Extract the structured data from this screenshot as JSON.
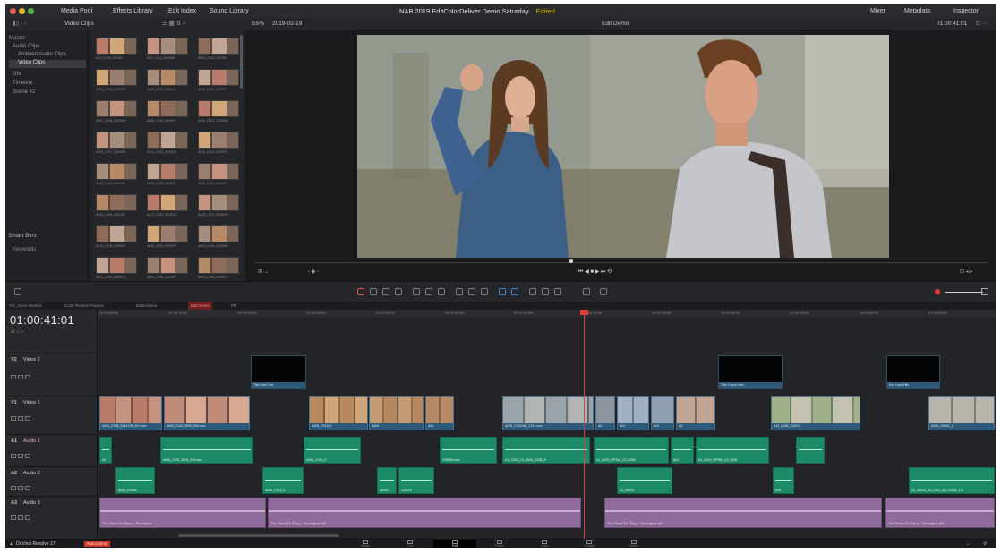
{
  "titlebar": {
    "tabs": [
      "Media Pool",
      "Effects Library",
      "Edit Index",
      "Sound Library"
    ],
    "title": "NAB 2019 EditColorDeliver Demo Saturday",
    "status": "Edited",
    "right_tabs": [
      "Mixer",
      "Metadata",
      "Inspector"
    ]
  },
  "toolbar2": {
    "bin": "Video Clips",
    "zoom": "55%",
    "timeline_name": "2019-02-19",
    "view": "Edit Demo",
    "source_tc": "01:00:41:01"
  },
  "bins": {
    "items": [
      "Master",
      "Audio Clips",
      "Ambient Audio Clips",
      "Video Clips",
      "Gfx",
      "Timeline",
      "Scene 42"
    ],
    "selected": "Video Clips",
    "smart_bins_label": "Smart Bins",
    "keywords_label": "Keywords"
  },
  "media_pool": {
    "clips": [
      "A01_C008_0519IR",
      "A02_C014_0520BB",
      "A003_C021_0520BC",
      "A004_C015_0519GR",
      "A005_C022_0521LK",
      "A006_C011_0520TT",
      "A007_C016_0519MR",
      "A008_C023_0519LP",
      "A009_C012_0520WA",
      "A010_C017_0521BM",
      "A011_C024_0519QN",
      "A012_C013_0520FD",
      "A013_C018_0521XR",
      "A014_C025_0519LK",
      "A015_C019_0520YT",
      "A016_C026_0521ZE",
      "A017_C020_0519CD",
      "A018_C027_0520HV",
      "A019_C028_0520KK",
      "A020_C029_0521RP",
      "A021_C030_0519MN",
      "A022_C031_0520PQ",
      "A023_C032_0521ST",
      "A024_C033_0519UV"
    ]
  },
  "timeline": {
    "timecode": "01:00:41:01",
    "tabs": [
      "Pre_Gone Reshot",
      "Color Reason Frames",
      "Edits Demo",
      "Edit Demo",
      "PR"
    ],
    "active_tab": "Edit Demo",
    "ruler": [
      "01:00:00:00",
      "01:00:10:00",
      "01:00:20:00",
      "01:00:30:00",
      "01:00:40:00",
      "01:00:50:00",
      "01:01:00:00",
      "01:01:10:00",
      "01:01:20:00",
      "01:01:30:00",
      "01:01:40:00",
      "01:01:50:00",
      "01:02:00:00"
    ],
    "tracks": [
      {
        "id": "V2",
        "name": "Video 2"
      },
      {
        "id": "V1",
        "name": "Video 1"
      },
      {
        "id": "A1",
        "name": "Audio 1"
      },
      {
        "id": "A2",
        "name": "Audio 2"
      },
      {
        "id": "A3",
        "name": "Audio 3"
      }
    ],
    "v2_clips": [
      "Title Card Text",
      "Title Fusion Intro",
      "End Card Title"
    ],
    "v1_clips": [
      "A004_C008_0519JJR_001.mov",
      "A006_C021_0520_006.mov",
      "A006_C013_0",
      "A006",
      "A04",
      "A006_C021046_C011.mov",
      "A0",
      "A01",
      "A01",
      "A0",
      "A19_A026_C0013",
      "A005_C0004_1"
    ],
    "a1_clips": [
      "A1",
      "A006_C007_0519_005.mov",
      "A006_C013_0",
      "C00500.mov",
      "A1_C021_C0_A006_C008_A",
      "A1_A019_SPTA2_C0_0006",
      "A01",
      "A1_A019_SPTA2_C0_0006",
      ""
    ],
    "a2_clips": [
      "A008_C0048",
      "A006_C013_0",
      "A005C",
      "C00 E5",
      "A1_A0019",
      "A04",
      "A1_A0011_A0_C011_A0_C0001_13"
    ],
    "a3_clips": [
      "The Road To Glory - Tourniquet",
      "The Road To Glory - Tourniquet.aiff",
      "The Road To Glory - Tourniquet.aiff",
      "The Road To Glory - Tourniquet.aiff"
    ]
  },
  "pagebar": {
    "brand": "DaVinci Resolve 17",
    "badge": "PUBLIC BETA",
    "pages": [
      "Media",
      "Cut",
      "Edit",
      "Fusion",
      "Color",
      "Fairlight",
      "Deliver"
    ],
    "active_page": "Edit"
  },
  "colors": {
    "video_clip": "#6e8fa8",
    "audio_clip": "#1c8a66",
    "music_clip": "#8e6b9a",
    "playhead": "#e03a3a",
    "accent": "#d4b400"
  }
}
